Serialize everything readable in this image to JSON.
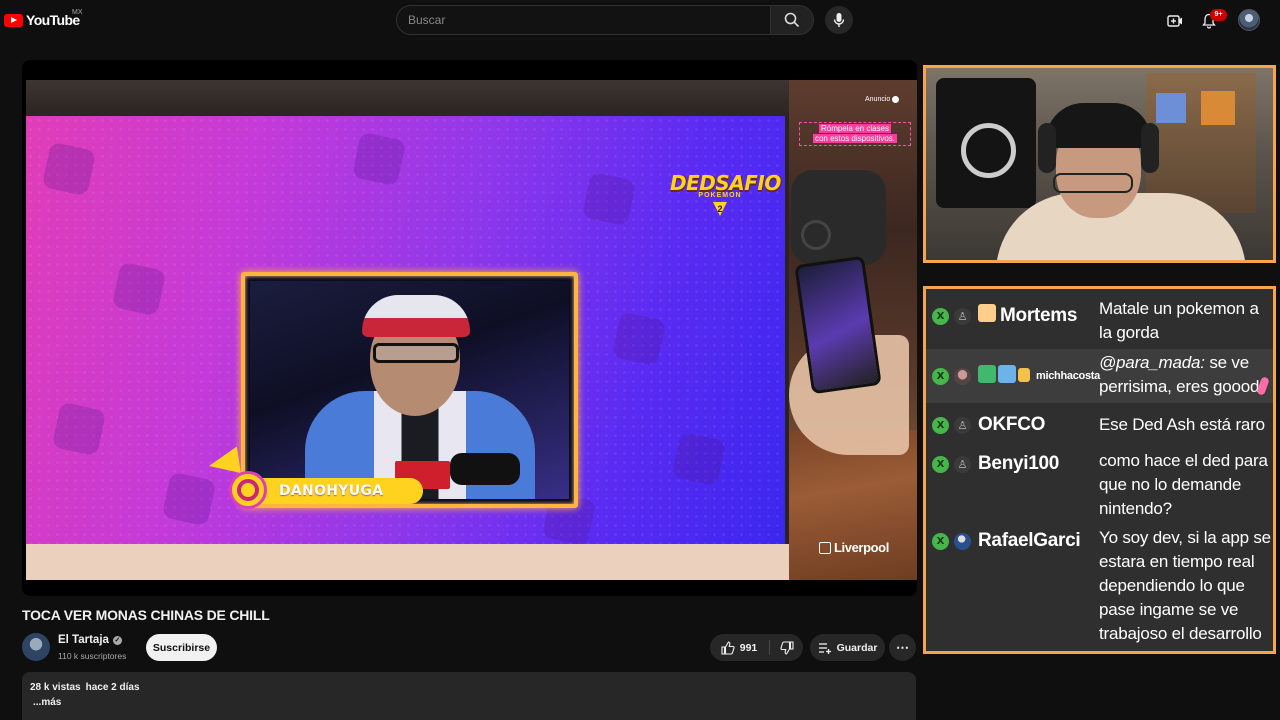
{
  "header": {
    "logo_text": "YouTube",
    "country_code": "MX",
    "search_placeholder": "Buscar",
    "notification_count": "9+"
  },
  "video": {
    "overlay_logo_title": "DEDSAFIO",
    "overlay_logo_sub": "POKEMON",
    "overlay_logo_num": "2",
    "nametag": "DANOHYUGA",
    "ad": {
      "label": "Anuncio",
      "headline_line1": "Rómpela en clases",
      "headline_line2": "con estos dispositivos.",
      "brand": "Liverpool"
    }
  },
  "chat": {
    "messages": [
      {
        "user": "Mortems",
        "text": "Matale un pokemon a la gorda",
        "highlighted": false
      },
      {
        "user": "michhacosta",
        "mention": "@para_mada:",
        "text": "se ve perrisima, eres goood",
        "highlighted": true
      },
      {
        "user": "OKFCO",
        "text": "Ese Ded Ash está raro",
        "highlighted": false
      },
      {
        "user": "Benyi100",
        "text": "como hace el ded para que no lo demande nintendo?",
        "highlighted": false
      },
      {
        "user": "RafaelGarci",
        "text": "Yo soy dev, si la app se estara en tiempo real dependiendo lo que pase ingame se ve trabajoso el desarrollo",
        "highlighted": false
      }
    ]
  },
  "meta": {
    "title": "TOCA VER MONAS CHINAS DE CHILL",
    "channel_name": "El Tartaja",
    "subscribers": "110 k suscriptores",
    "subscribe_label": "Suscribirse",
    "likes": "991",
    "save_label": "Guardar",
    "views": "28 k vistas",
    "date": "hace 2 días",
    "more_label": "...más"
  },
  "colors": {
    "frame_accent": "#f5a54b",
    "youtube_red": "#ff0000",
    "chat_badge": "#46b54a",
    "nametag_yellow": "#ffd21f"
  },
  "icons": [
    "youtube-logo-icon",
    "search-icon",
    "mic-icon",
    "create-icon",
    "bell-icon",
    "verified-icon",
    "like-icon",
    "dislike-icon",
    "save-icon",
    "more-icon"
  ]
}
